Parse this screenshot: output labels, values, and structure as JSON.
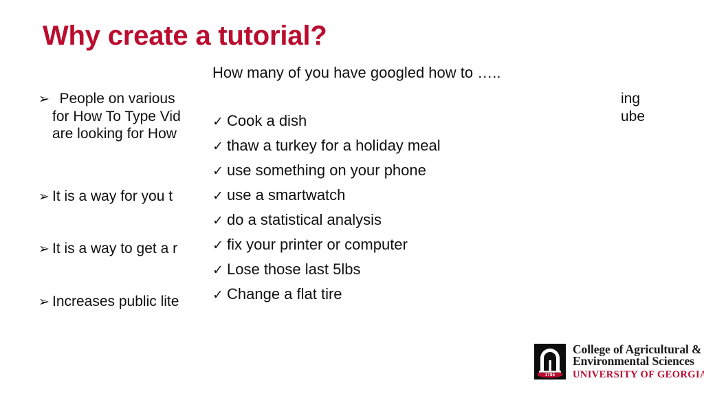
{
  "slide": {
    "title": "Why create a tutorial?",
    "title_color": "#BA0C2F",
    "background_color": "#FFFFFF"
  },
  "left_bullets": {
    "marker_glyph": "➢",
    "items": [
      {
        "lines": [
          " People on various",
          "for How To Type Vid",
          "are looking for How"
        ],
        "occluded_tail_lines": [
          "ing",
          "ube",
          ""
        ]
      },
      {
        "lines": [
          "It is a way for you t"
        ],
        "occluded_tail_lines": [
          ""
        ]
      },
      {
        "lines": [
          "It is a way to get a r"
        ],
        "occluded_tail_lines": [
          ""
        ]
      },
      {
        "lines": [
          "Increases public lite"
        ],
        "occluded_tail_lines": [
          ""
        ]
      }
    ]
  },
  "overlay": {
    "heading": "How many of you have googled how to …..",
    "check_glyph": "✓",
    "items": [
      "Cook a dish",
      "thaw a turkey for a holiday meal",
      "use something on your phone",
      "use a smartwatch",
      "do a statistical analysis",
      "fix your printer or computer",
      "Lose those last 5lbs",
      "Change a flat tire"
    ]
  },
  "logo": {
    "emblem_name": "uga-arch-icon",
    "founded_year": "1785",
    "line1": "College of Agricultural &",
    "line2": "Environmental Sciences",
    "line3": "UNIVERSITY OF GEORGIA",
    "accent_color": "#BA0C2F"
  }
}
